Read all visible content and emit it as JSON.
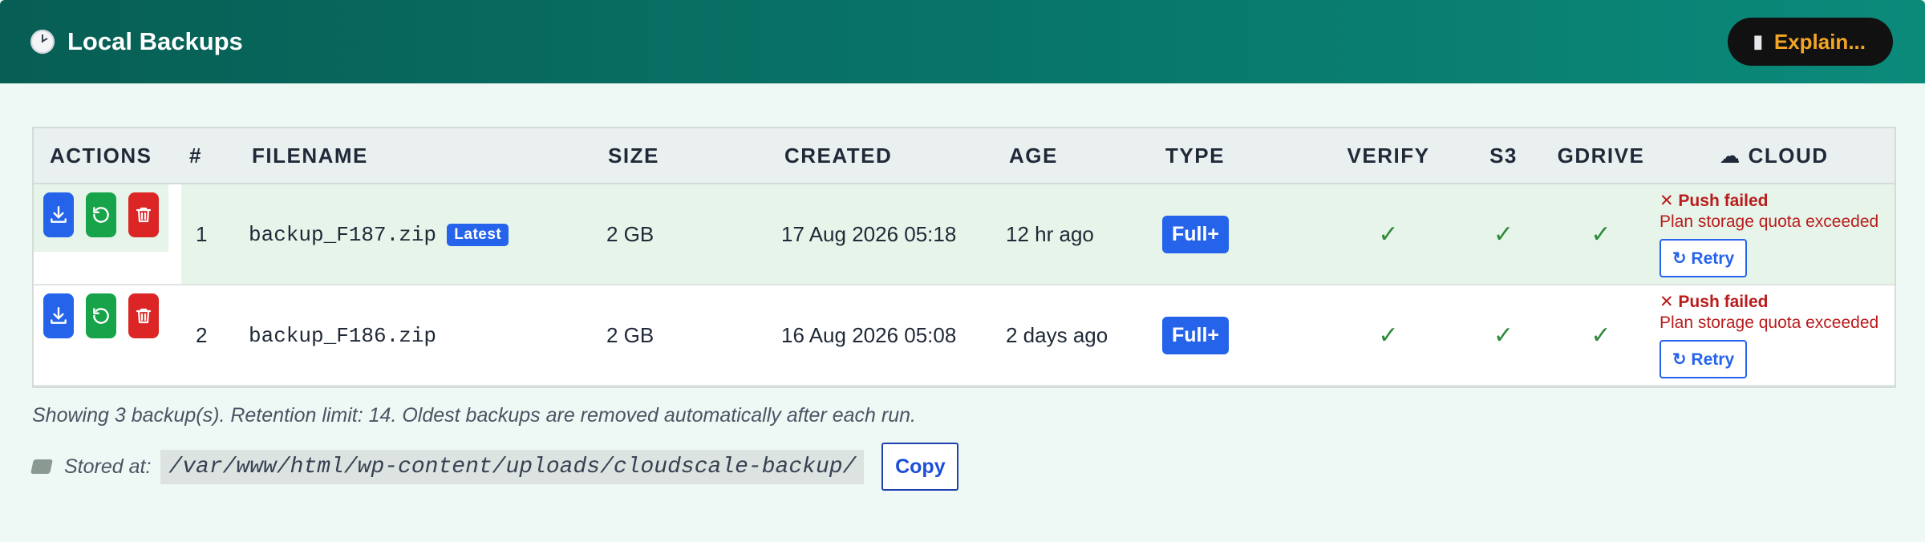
{
  "header": {
    "title": "Local Backups",
    "icon": "clock-icon",
    "explain_label": "Explain...",
    "explain_icon": "book-icon"
  },
  "table": {
    "columns": [
      "ACTIONS",
      "#",
      "FILENAME",
      "SIZE",
      "CREATED",
      "AGE",
      "TYPE",
      "VERIFY",
      "S3",
      "GDRIVE",
      "CLOUD"
    ],
    "cloud_header_icon": "cloud-icon",
    "rows": [
      {
        "num": "1",
        "filename": "backup_F187.zip",
        "badge": "Latest",
        "size": "2 GB",
        "created": "17 Aug 2026 05:18",
        "age": "12 hr ago",
        "type": "Full+",
        "verify": "✓",
        "s3": "✓",
        "gdrive": "✓",
        "cloud_status": "✕ Push failed",
        "cloud_reason": "Plan storage quota exceeded",
        "retry_label": "↻ Retry"
      },
      {
        "num": "2",
        "filename": "backup_F186.zip",
        "size": "2 GB",
        "created": "16 Aug 2026 05:08",
        "age": "2 days ago",
        "type": "Full+",
        "verify": "✓",
        "s3": "✓",
        "gdrive": "✓",
        "cloud_status": "✕ Push failed",
        "cloud_reason": "Plan storage quota exceeded",
        "retry_label": "↻ Retry"
      }
    ]
  },
  "footer": {
    "note": "Showing 3 backup(s). Retention limit: 14. Oldest backups are removed automatically after each run.",
    "stored_label": "Stored at:",
    "path": "/var/www/html/wp-content/uploads/cloudscale-backup/",
    "copy_label": "Copy"
  },
  "colors": {
    "header_start": "#075e54",
    "header_end": "#0b8a7a",
    "accent_blue": "#2563eb",
    "success_green": "#16a34a",
    "danger_red": "#dc2626",
    "latest_row_bg": "#e6f4e9"
  }
}
